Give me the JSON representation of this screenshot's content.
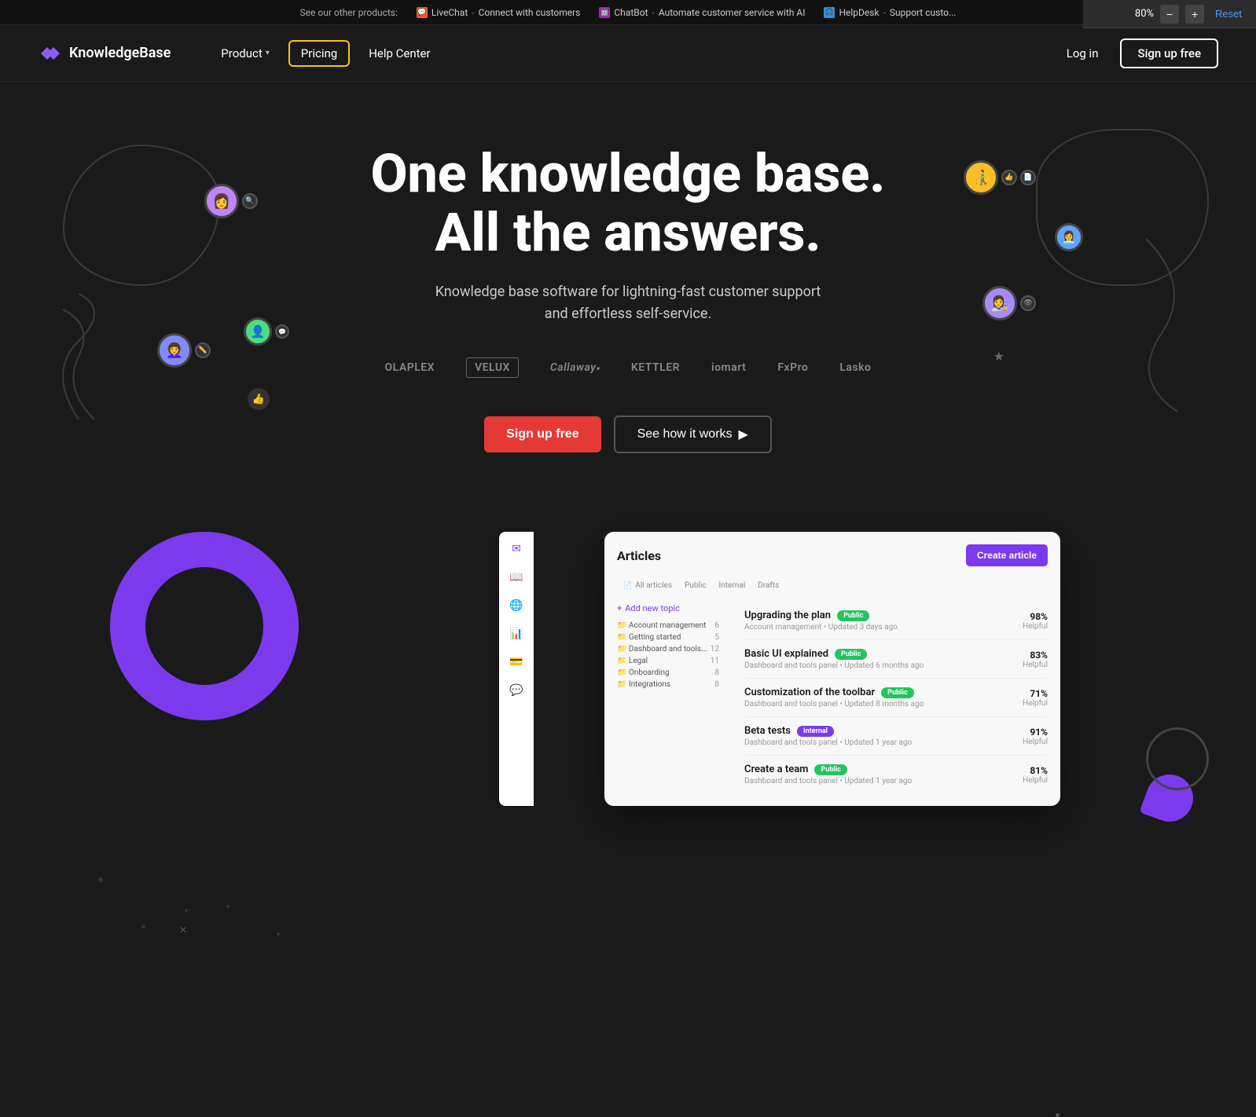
{
  "browser": {
    "zoom": "80%",
    "minus_label": "−",
    "plus_label": "+",
    "reset_label": "Reset"
  },
  "announcement": {
    "see_other": "See our other products:",
    "livechat_label": "LiveChat",
    "livechat_desc": "Connect with customers",
    "chatbot_label": "ChatBot",
    "chatbot_desc": "Automate customer service with AI",
    "helpdesk_label": "HelpDesk",
    "helpdesk_desc": "Support custo..."
  },
  "nav": {
    "logo_text": "KnowledgeBase",
    "product_label": "Product",
    "pricing_label": "Pricing",
    "help_center_label": "Help Center",
    "login_label": "Log in",
    "signup_label": "Sign up free"
  },
  "hero": {
    "title_line1": "One knowledge base.",
    "title_line2": "All the answers.",
    "subtitle": "Knowledge base software for lightning-fast customer support and effortless self-service.",
    "cta_primary": "Sign up free",
    "cta_secondary": "See how it works",
    "cta_arrow": "▶"
  },
  "brands": [
    {
      "name": "OLAPLEX",
      "style": "plain"
    },
    {
      "name": "VELUX",
      "style": "boxed"
    },
    {
      "name": "Callaway",
      "style": "plain"
    },
    {
      "name": "KETTLER",
      "style": "plain"
    },
    {
      "name": "iomart",
      "style": "plain"
    },
    {
      "name": "FxPro",
      "style": "plain"
    },
    {
      "name": "Lasko",
      "style": "plain"
    }
  ],
  "mockup": {
    "articles_title": "Articles",
    "create_btn": "Create article",
    "nav_items": [
      {
        "label": "All articles",
        "active": false
      },
      {
        "label": "Public",
        "active": false
      },
      {
        "label": "Internal",
        "active": false
      },
      {
        "label": "Drafts",
        "active": false
      }
    ],
    "sidebar_links": [
      {
        "label": "Add new topic",
        "count": ""
      },
      {
        "label": "Account management",
        "count": "6"
      },
      {
        "label": "Getting started",
        "count": "5"
      },
      {
        "label": "Dashboard and tools...",
        "count": "12"
      },
      {
        "label": "Legal",
        "count": "11"
      },
      {
        "label": "Onboarding",
        "count": "8"
      },
      {
        "label": "Integrations",
        "count": "8"
      }
    ],
    "articles": [
      {
        "name": "Upgrading the plan",
        "badge": "Public",
        "badge_type": "public",
        "meta": "Account management • Updated 3 days ago",
        "percent": "98%",
        "stat_label": "Helpful"
      },
      {
        "name": "Basic UI explained",
        "badge": "Public",
        "badge_type": "public",
        "meta": "Dashboard and tools panel • Updated 6 months ago",
        "percent": "83%",
        "stat_label": "Helpful"
      },
      {
        "name": "Customization of the toolbar",
        "badge": "Public",
        "badge_type": "public",
        "meta": "Dashboard and tools panel • Updated 8 months ago",
        "percent": "71%",
        "stat_label": "Helpful"
      },
      {
        "name": "Beta tests",
        "badge": "Internal",
        "badge_type": "internal",
        "meta": "Dashboard and tools panel • Updated 1 year ago",
        "percent": "91%",
        "stat_label": "Helpful"
      },
      {
        "name": "Create a team",
        "badge": "Public",
        "badge_type": "public",
        "meta": "Dashboard and tools panel • Updated 1 year ago",
        "percent": "81%",
        "stat_label": "Helpful"
      }
    ]
  }
}
